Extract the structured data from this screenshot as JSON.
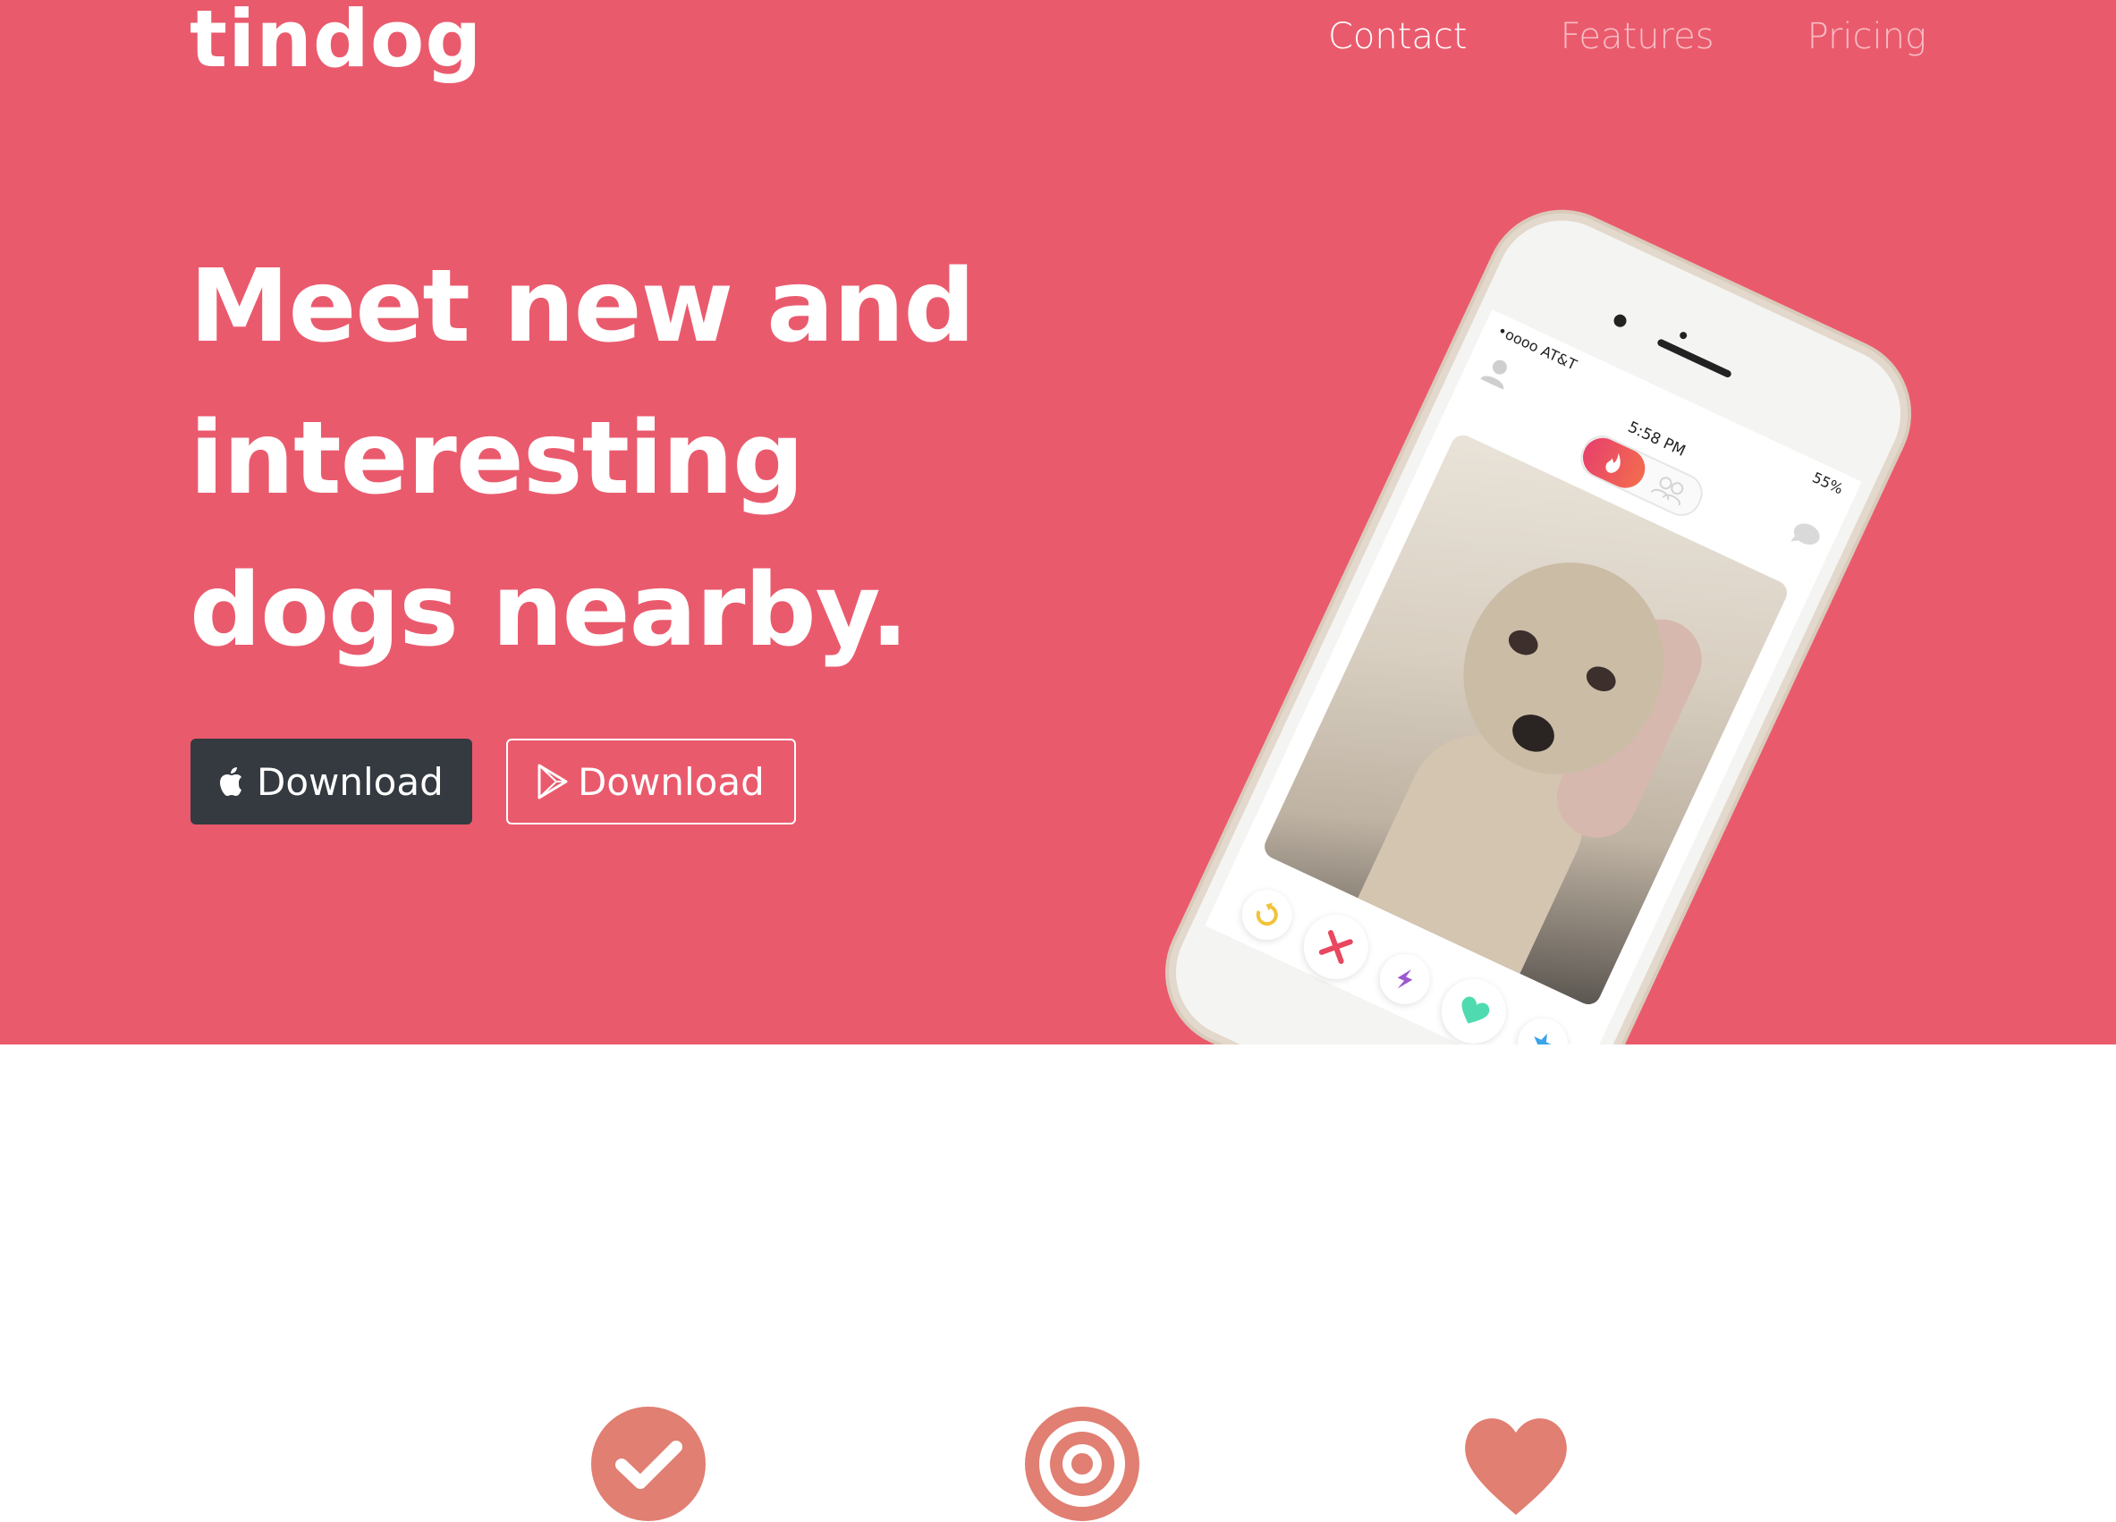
{
  "brand": {
    "name": "tindog"
  },
  "nav": {
    "items": [
      {
        "label": "Contact"
      },
      {
        "label": "Features"
      },
      {
        "label": "Pricing"
      }
    ]
  },
  "hero": {
    "headline_lines": [
      "Meet new and",
      "interesting",
      "dogs nearby."
    ],
    "buttons": {
      "apple_download": "Download",
      "play_download": "Download"
    }
  },
  "phone": {
    "carrier": "•oooo AT&T",
    "time": "5:58 PM",
    "battery": "55%"
  },
  "features": {
    "icons": [
      "check-circle-icon",
      "bullseye-icon",
      "heart-icon"
    ]
  },
  "colors": {
    "hero_bg": "#ea5a6d",
    "dark_button": "#343a40",
    "feature_icon": "#e07f72"
  }
}
